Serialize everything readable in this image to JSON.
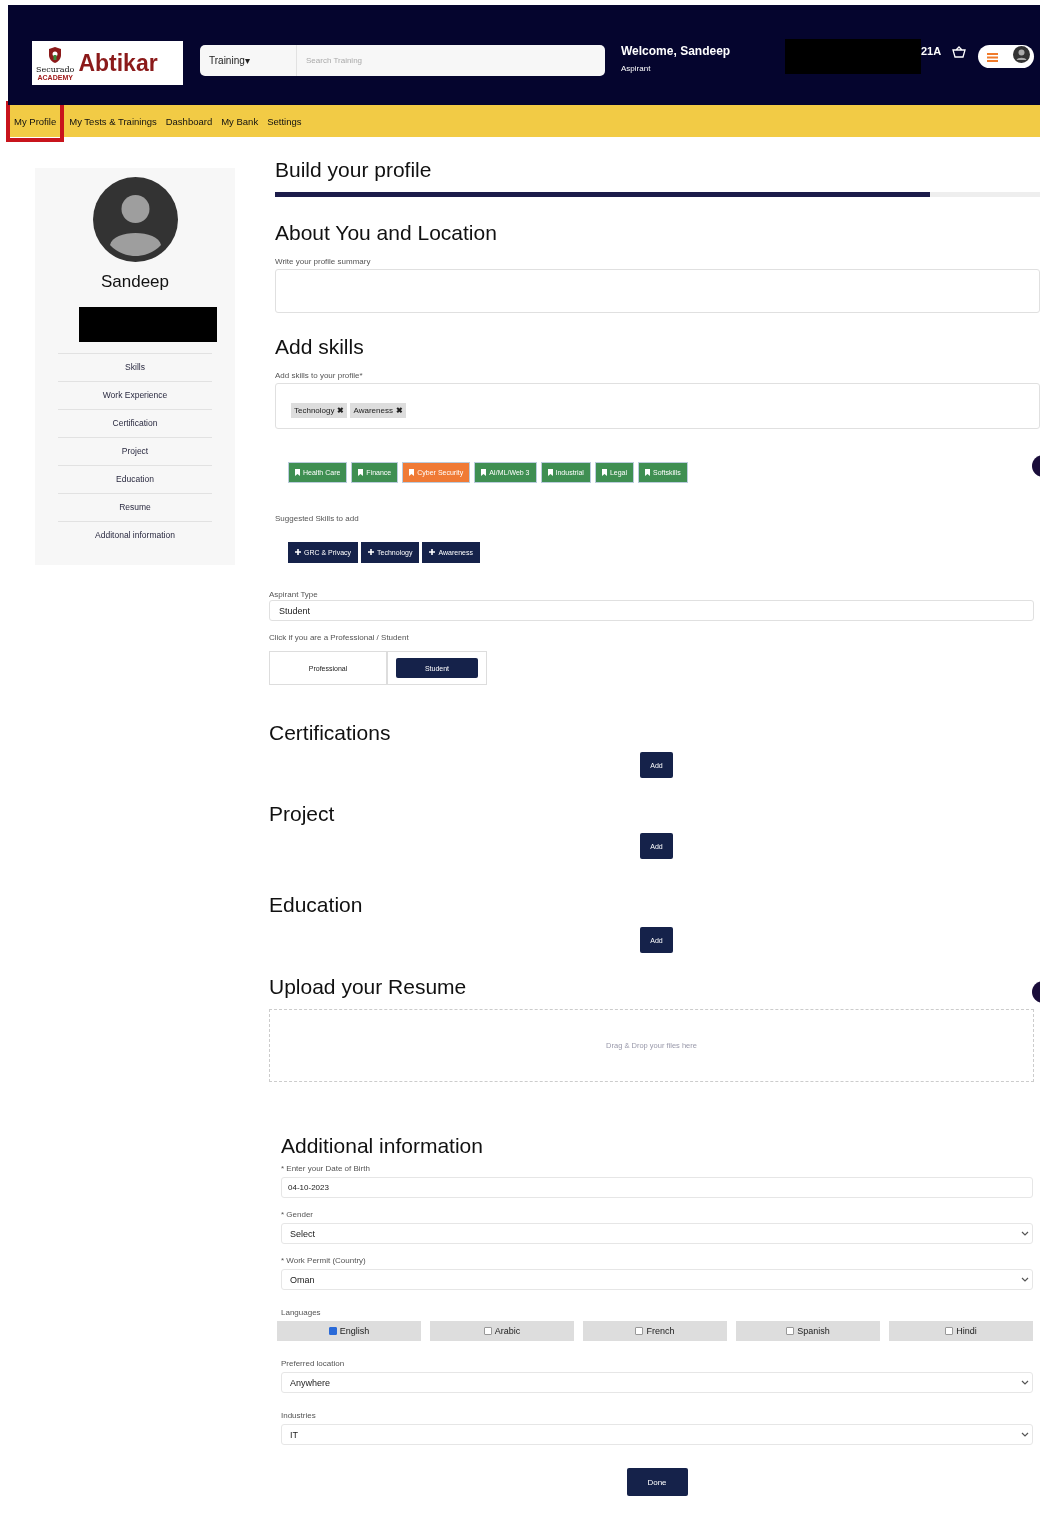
{
  "header": {
    "logo": {
      "name": "Abtikar",
      "org": "Securado",
      "org_sub": "ACADEMY"
    },
    "search": {
      "category": "Training",
      "caret": "▾",
      "placeholder": "Search Training"
    },
    "welcome": "Welcome, Sandeep",
    "role": "Aspirant",
    "redacted": true,
    "code": "21A"
  },
  "nav": [
    {
      "label": "My Profile",
      "selected": true
    },
    {
      "label": "My Tests & Trainings",
      "selected": false
    },
    {
      "label": "Dashboard",
      "selected": false
    },
    {
      "label": "My Bank",
      "selected": false
    },
    {
      "label": "Settings",
      "selected": false
    }
  ],
  "sidebar": {
    "name": "Sandeep",
    "redacted": true,
    "items": [
      "Skills",
      "Work Experience",
      "Certification",
      "Project",
      "Education",
      "Resume",
      "Additonal information"
    ]
  },
  "main": {
    "title": "Build your profile",
    "progress": {
      "level": 0.856
    },
    "about": {
      "heading": "About You and Location",
      "label": "Write your profile summary"
    },
    "skills": {
      "heading": "Add skills",
      "label": "Add skills to your profile*",
      "tags": [
        {
          "label": "Technology",
          "remove": "✖"
        },
        {
          "label": "Awareness",
          "remove": "✖"
        }
      ],
      "categories": [
        {
          "label": "Health Care",
          "selected": false
        },
        {
          "label": "Finance",
          "selected": false
        },
        {
          "label": "Cyber Security",
          "selected": true
        },
        {
          "label": "AI/ML/Web 3",
          "selected": false
        },
        {
          "label": "Industrial",
          "selected": false
        },
        {
          "label": "Legal",
          "selected": false
        },
        {
          "label": "Softskills",
          "selected": false
        }
      ],
      "suggested_label": "Suggested Skills to add",
      "suggested": [
        "GRC & Privacy",
        "Technology",
        "Awareness"
      ]
    },
    "aspirant": {
      "label": "Aspirant Type",
      "value": "Student",
      "click_label": "Click if you are a Professional / Student",
      "options": [
        {
          "label": "Professional",
          "selected": false
        },
        {
          "label": "Student",
          "selected": true
        }
      ]
    },
    "sections": [
      {
        "heading": "Certifications",
        "button": "Add"
      },
      {
        "heading": "Project",
        "button": "Add"
      },
      {
        "heading": "Education",
        "button": "Add"
      }
    ],
    "resume": {
      "heading": "Upload your Resume",
      "dropzone": "Drag & Drop your files here"
    }
  },
  "additional": {
    "heading": "Additional information",
    "fields": [
      {
        "kind": "input",
        "label": "* Enter your Date of Birth",
        "value": "04-10-2023"
      },
      {
        "kind": "select",
        "label": "* Gender",
        "value": "Select"
      },
      {
        "kind": "select",
        "label": "* Work Permit (Country)",
        "value": "Oman"
      },
      {
        "kind": "checks",
        "label": "Languages",
        "options": [
          {
            "label": "English",
            "checked": true
          },
          {
            "label": "Arabic",
            "checked": false
          },
          {
            "label": "French",
            "checked": false
          },
          {
            "label": "Spanish",
            "checked": false
          },
          {
            "label": "Hindi",
            "checked": false
          }
        ]
      },
      {
        "kind": "select",
        "label": "Preferred location",
        "value": "Anywhere"
      },
      {
        "kind": "select",
        "label": "Industries",
        "value": "IT"
      }
    ],
    "button": "Done"
  }
}
